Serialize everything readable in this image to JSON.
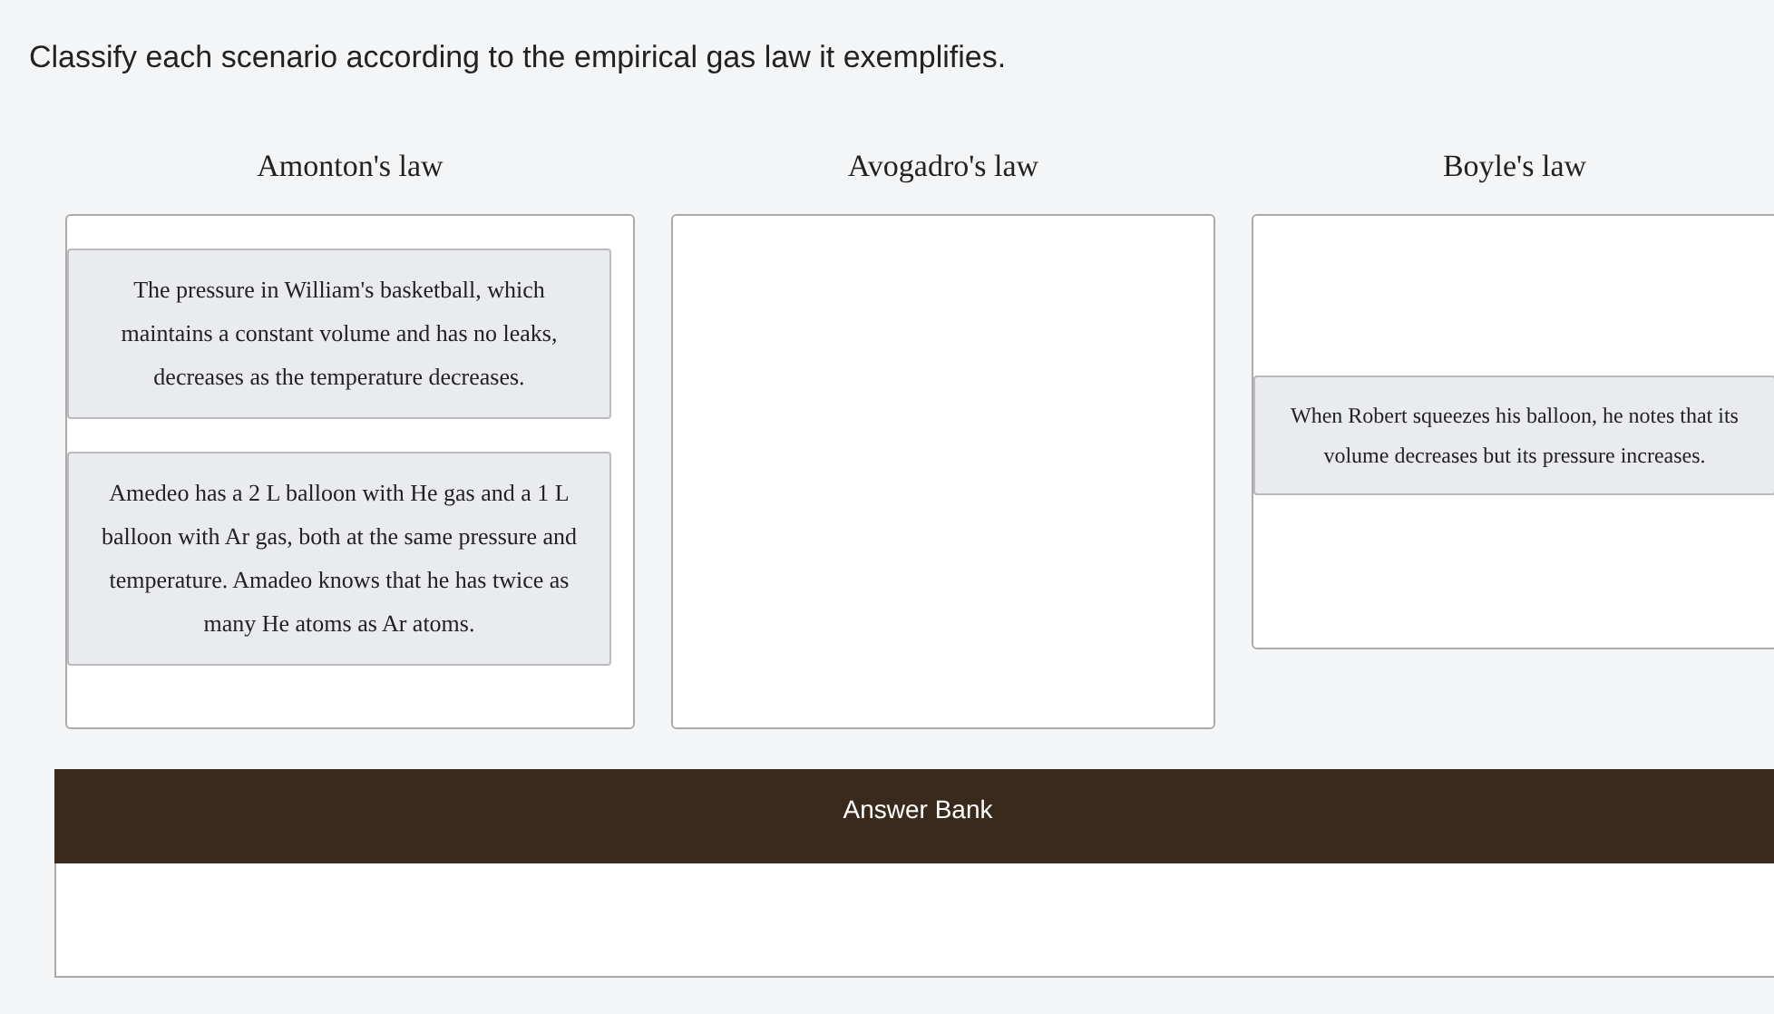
{
  "instruction": "Classify each scenario according to the empirical gas law it exemplifies.",
  "categories": [
    {
      "label": "Amonton's law",
      "items": [
        "The pressure in William's basketball, which maintains a constant volume and has no leaks, decreases as the temperature decreases.",
        "Amedeo has a 2 L balloon with He gas and a 1 L balloon with Ar gas, both at the same pressure and temperature. Amadeo knows that he has twice as many He atoms as Ar atoms."
      ]
    },
    {
      "label": "Avogadro's law"
    },
    {
      "label": "Boyle's law",
      "items": [
        "When Robert squeezes his balloon, he notes that its volume decreases but its pressure increases."
      ]
    }
  ],
  "answer_bank": {
    "title": "Answer Bank"
  }
}
